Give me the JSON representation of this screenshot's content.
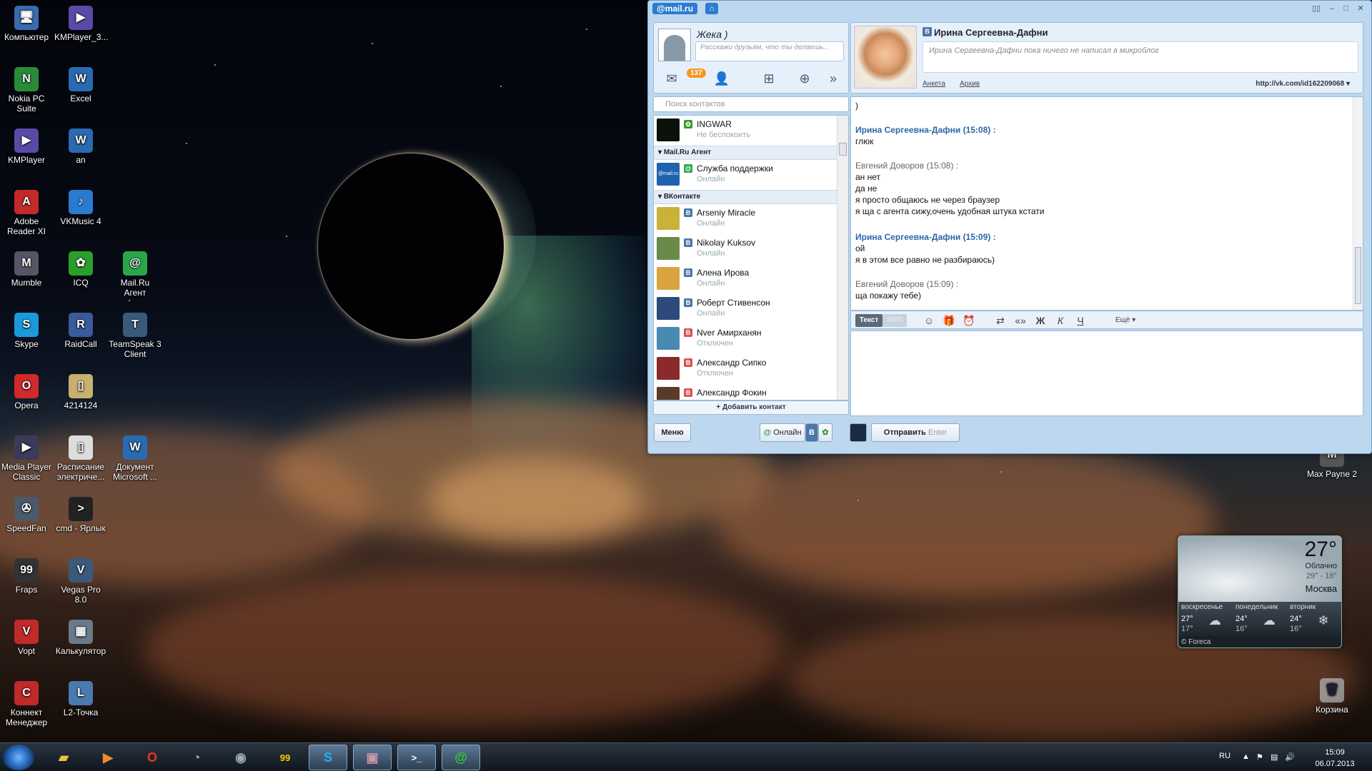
{
  "desktop": {
    "icons": [
      {
        "label": "Компьютер",
        "glyph": "🖥"
      },
      {
        "label": "KMPlayer_3...",
        "glyph": "▶"
      },
      {
        "label": "Nokia PC Suite",
        "glyph": "N"
      },
      {
        "label": "Excel",
        "glyph": "W"
      },
      {
        "label": "KMPlayer",
        "glyph": "▶"
      },
      {
        "label": "an",
        "glyph": "W"
      },
      {
        "label": "Adobe Reader XI",
        "glyph": "A"
      },
      {
        "label": "VKMusic 4",
        "glyph": "♪"
      },
      {
        "label": "Mumble",
        "glyph": "M"
      },
      {
        "label": "ICQ",
        "glyph": "✿"
      },
      {
        "label": "Mail.Ru Агент",
        "glyph": "@"
      },
      {
        "label": "Skype",
        "glyph": "S"
      },
      {
        "label": "RaidCall",
        "glyph": "R"
      },
      {
        "label": "TeamSpeak 3 Client",
        "glyph": "T"
      },
      {
        "label": "Opera",
        "glyph": "O"
      },
      {
        "label": "4214124",
        "glyph": "▯"
      },
      {
        "label": "Media Player Classic",
        "glyph": "▶"
      },
      {
        "label": "Расписание электриче...",
        "glyph": "▯"
      },
      {
        "label": "Документ Microsoft ...",
        "glyph": "W"
      },
      {
        "label": "SpeedFan",
        "glyph": "✇"
      },
      {
        "label": "cmd - Ярлык",
        "glyph": ">"
      },
      {
        "label": "Fraps",
        "glyph": "99"
      },
      {
        "label": "Vegas Pro 8.0",
        "glyph": "V"
      },
      {
        "label": "Vopt",
        "glyph": "V"
      },
      {
        "label": "Калькулятор",
        "glyph": "▦"
      },
      {
        "label": "Коннект Менеджер",
        "glyph": "C"
      },
      {
        "label": "L2-Точка",
        "glyph": "L"
      }
    ],
    "right_icons": [
      {
        "label": "Max Payne 2"
      },
      {
        "label": "Корзина",
        "glyph": "🗑"
      }
    ]
  },
  "agent": {
    "logo": "@mail.ru",
    "profile": {
      "name": "Жека )",
      "status_placeholder": "Расскажи друзьям, что ты делаешь...",
      "mail_count": "137"
    },
    "search_placeholder": "Поиск контактов",
    "top_contact": {
      "name": "INGWAR",
      "status": "Не беспокоить"
    },
    "groups": [
      {
        "title": "Mail.Ru Агент",
        "contacts": [
          {
            "name": "Служба поддержки",
            "status": "Онлайн",
            "avatar_text": "@mail.ru"
          }
        ]
      },
      {
        "title": "ВКонтакте",
        "contacts": [
          {
            "name": "Arseniy Miracle",
            "status": "Онлайн"
          },
          {
            "name": "Nikolay Kuksov",
            "status": "Онлайн"
          },
          {
            "name": "Алена Ирова",
            "status": "Онлайн"
          },
          {
            "name": "Роберт Стивенсон",
            "status": "Онлайн"
          },
          {
            "name": "Nver Амирханян",
            "status": "Отключен"
          },
          {
            "name": "Александр Сипко",
            "status": "Отключен"
          },
          {
            "name": "Александр Фокин",
            "status": ""
          }
        ]
      }
    ],
    "add_contact": "+ Добавить контакт",
    "menu_label": "Меню",
    "online_label": "Онлайн",
    "chat": {
      "contact_name": "Ирина Сергеевна-Дафни",
      "microblog": "Ирина Сергеевна-Дафни пока ничего не написал в микроблог",
      "link_profile": "Анкета",
      "link_archive": "Архив",
      "profile_url": "http://vk.com/id162209068",
      "messages": [
        {
          "line": ")"
        },
        {
          "author": "Ирина Сергеевна-Дафни (15:08) :",
          "lines": [
            "глюк"
          ],
          "her": true
        },
        {
          "author": "Евгений Доворов (15:08) :",
          "lines": [
            "ан нет",
            "да не",
            "я просто общаюсь не через браузер",
            "я ща с агента сижу,очень удобная штука кстати"
          ],
          "her": false
        },
        {
          "author": "Ирина Сергеевна-Дафни (15:09) :",
          "lines": [
            "ой",
            "я в этом все равно не разбираюсь)"
          ],
          "her": true
        },
        {
          "author": "Евгений Доворов (15:09) :",
          "lines": [
            "ща покажу тебе)"
          ],
          "her": false
        }
      ],
      "toolbar": {
        "tab_text": "Текст",
        "tab_sms": "SMS",
        "bold": "Ж",
        "italic": "К",
        "underline": "Ч",
        "more": "Ещё"
      },
      "send_label": "Отправить",
      "send_hint": "Enter"
    }
  },
  "weather": {
    "temp": "27°",
    "condition": "Облачно",
    "range": "29° - 18°",
    "city": "Москва",
    "days": [
      {
        "name": "воскресенье",
        "hi": "27°",
        "lo": "17°"
      },
      {
        "name": "понедельник",
        "hi": "24°",
        "lo": "16°"
      },
      {
        "name": "вторник",
        "hi": "24°",
        "lo": "16°"
      }
    ],
    "source": "© Foreca"
  },
  "taskbar": {
    "lang": "RU",
    "time": "15:09",
    "date": "06.07.2013"
  }
}
